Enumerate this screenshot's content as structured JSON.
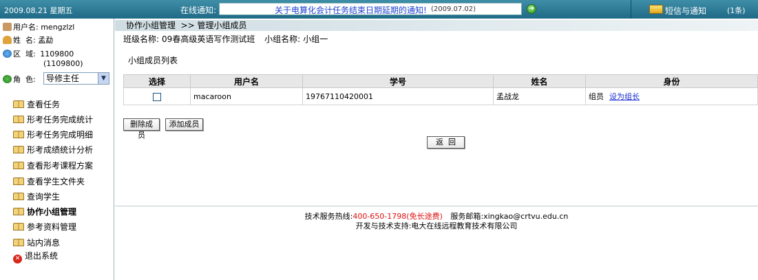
{
  "topbar": {
    "date": "2009.08.21 星期五",
    "notice_label": "在线通知:",
    "notice_title": "关于电算化会计任务结束日期延期的通知!",
    "notice_date": "(2009.07.02)",
    "mail_label": "短信与通知",
    "mail_count": "(1条)"
  },
  "sidebar": {
    "username_label": "用户名:",
    "username": "mengzlzl",
    "name_label": "姓  名:",
    "name": "孟勐",
    "area_label": "区  域:",
    "area_code": "1109800",
    "area_code2": "(1109800)",
    "role_label": "角  色:",
    "role_selected": "导修主任",
    "nav": [
      {
        "label": "查看任务"
      },
      {
        "label": "形考任务完成统计"
      },
      {
        "label": "形考任务完成明细"
      },
      {
        "label": "形考成绩统计分析"
      },
      {
        "label": "查看形考课程方案"
      },
      {
        "label": "查看学生文件夹"
      },
      {
        "label": "查询学生"
      },
      {
        "label": "协作小组管理"
      },
      {
        "label": "参考资料管理"
      },
      {
        "label": "站内消息"
      },
      {
        "label": "退出系统"
      }
    ]
  },
  "main": {
    "breadcrumb": "协作小组管理  >> 管理小组成员",
    "class_label": "班级名称:",
    "class_name": "09春高级英语写作测试班",
    "group_label": "小组名称:",
    "group_name": "小组一",
    "list_title": "小组成员列表",
    "table": {
      "headers": [
        "选择",
        "用户名",
        "学号",
        "姓名",
        "身份"
      ],
      "rows": [
        {
          "username": "macaroon",
          "student_id": "19767110420001",
          "name": "孟战龙",
          "role": "组员",
          "action": "设为组长"
        }
      ]
    },
    "delete_button": "删除成员",
    "add_button": "添加成员",
    "back_button": "返  回"
  },
  "footer": {
    "hotline_label": "技术服务热线:",
    "hotline": "400-650-1798",
    "hotline_note": "(免长途费)",
    "email_label": "服务邮箱:",
    "email": "xingkao@crtvu.edu.cn",
    "support": "开发与技术支持:电大在线远程教育技术有限公司"
  }
}
